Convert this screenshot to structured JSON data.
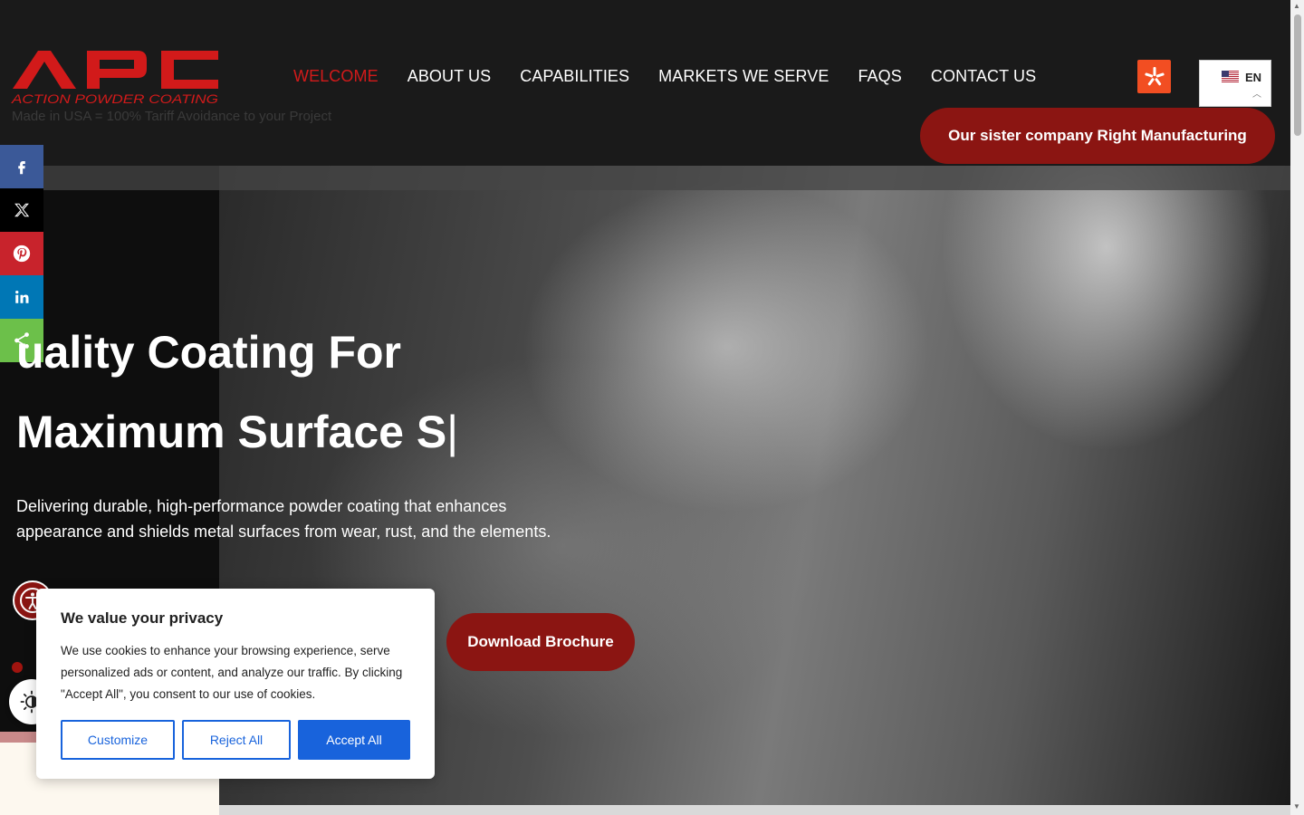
{
  "brand": {
    "logo_letters": "APC",
    "logo_subtitle": "ACTION POWDER COATING",
    "tagline": "Made in USA = 100% Tariff Avoidance to your Project"
  },
  "nav": {
    "items": [
      "WELCOME",
      "ABOUT US",
      "CAPABILITIES",
      "MARKETS WE SERVE",
      "FAQS",
      "CONTACT US"
    ],
    "active": "WELCOME"
  },
  "language": {
    "code": "EN"
  },
  "header_cta": {
    "label": "Our sister company Right Manufacturing"
  },
  "social": {
    "items": [
      "facebook",
      "x",
      "pinterest",
      "linkedin",
      "share"
    ]
  },
  "hero": {
    "title_line1": "uality Coating For",
    "title_line2": "Maximum Surface S",
    "title_cursor": "|",
    "description": "Delivering durable, high-performance powder coating that enhances appearance and shields metal surfaces from wear, rust, and the elements.",
    "cta": "Download Brochure"
  },
  "cookie": {
    "title": "We value your privacy",
    "body": "We use cookies to enhance your browsing experience, serve personalized ads or content, and analyze our traffic. By clicking \"Accept All\", you consent to our use of cookies.",
    "customize": "Customize",
    "reject": "Reject All",
    "accept": "Accept All"
  },
  "colors": {
    "brand_red": "#8b1512",
    "logo_red": "#d21a1a",
    "cookie_blue": "#1863dc",
    "yelp_orange": "#f24e22"
  }
}
